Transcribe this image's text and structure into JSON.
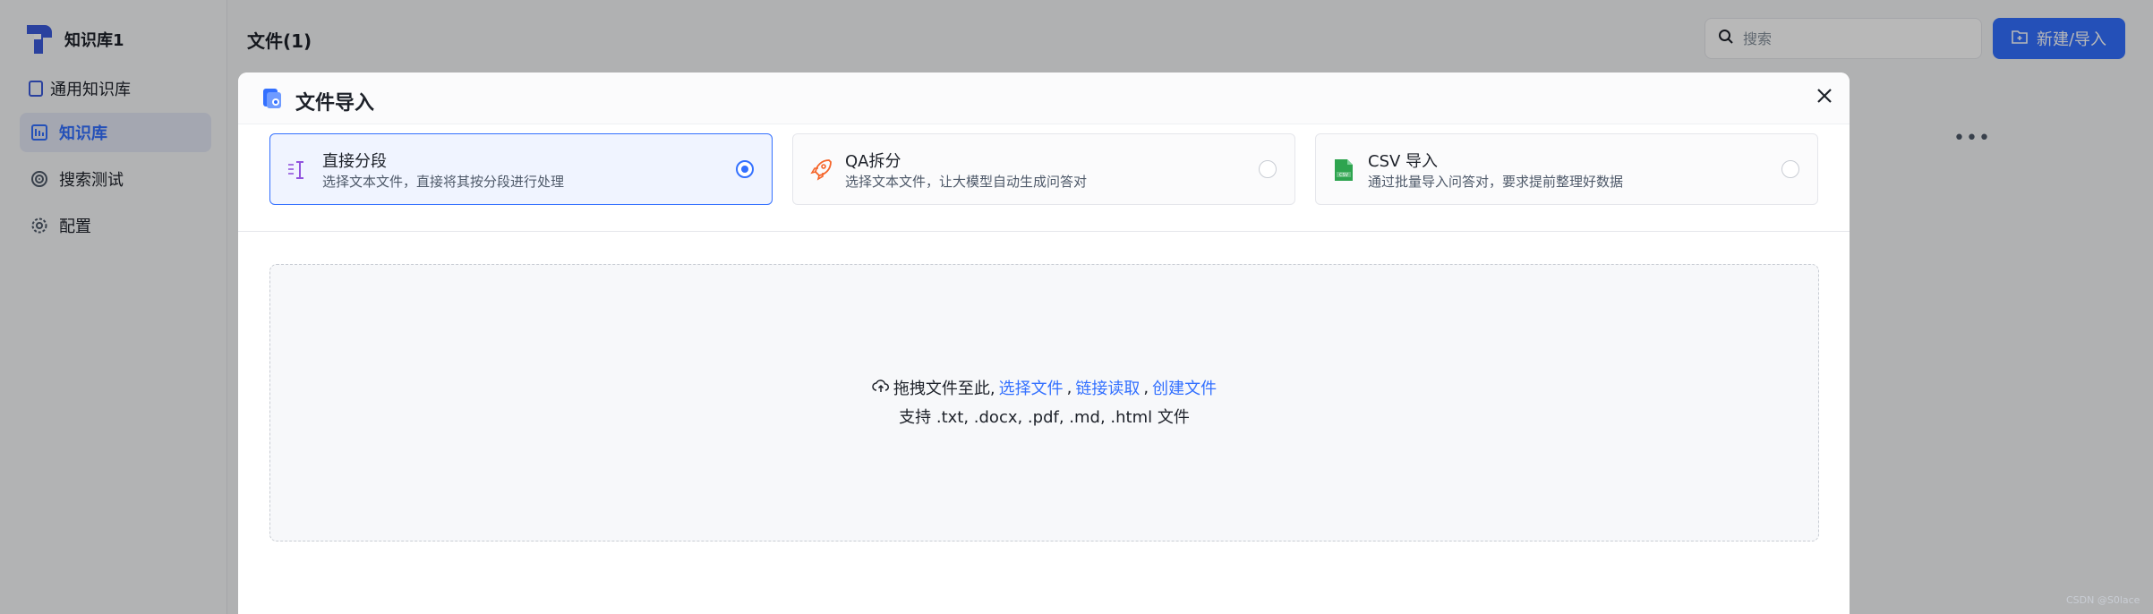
{
  "sidebar": {
    "kb_name": "知识库1",
    "sub_label": "通用知识库",
    "items": [
      {
        "label": "知识库",
        "icon": "dataset-icon",
        "active": true
      },
      {
        "label": "搜索测试",
        "icon": "target-icon",
        "active": false
      },
      {
        "label": "配置",
        "icon": "gear-icon",
        "active": false
      }
    ]
  },
  "header": {
    "title": "文件(1)",
    "search_placeholder": "搜索",
    "new_button": "新建/导入"
  },
  "modal": {
    "title": "文件导入",
    "options": [
      {
        "title": "直接分段",
        "desc": "选择文本文件，直接将其按分段进行处理",
        "selected": true,
        "icon": "text-cursor-icon"
      },
      {
        "title": "QA拆分",
        "desc": "选择文本文件，让大模型自动生成问答对",
        "selected": false,
        "icon": "rocket-icon"
      },
      {
        "title": "CSV 导入",
        "desc": "通过批量导入问答对，要求提前整理好数据",
        "selected": false,
        "icon": "csv-file-icon"
      }
    ],
    "dropzone": {
      "prefix": "拖拽文件至此,",
      "select_file": "选择文件",
      "link_read": "链接读取",
      "create_file": "创建文件",
      "sep": ",",
      "support": "支持 .txt, .docx, .pdf, .md, .html 文件"
    }
  },
  "watermark": "CSDN @S0lace",
  "colors": {
    "accent": "#3370ff",
    "overlay": "rgba(0,0,0,0.28)"
  }
}
